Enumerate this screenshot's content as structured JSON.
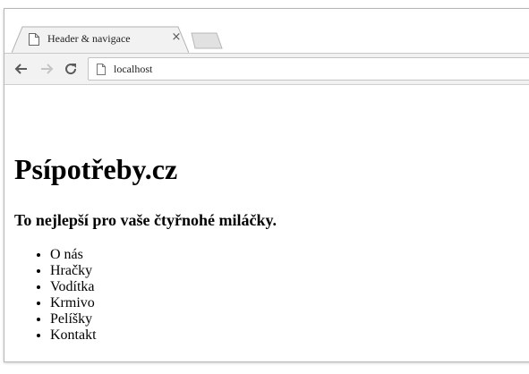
{
  "browser": {
    "tab": {
      "title": "Header & navigace",
      "close_glyph": "×",
      "favicon": "page-icon"
    },
    "address": {
      "url": "localhost",
      "icon": "page-icon"
    },
    "nav_icons": [
      "back-arrow-icon",
      "forward-arrow-icon",
      "reload-icon"
    ]
  },
  "page": {
    "title": "Psípotřeby.cz",
    "subtitle": "To nejlepší pro vaše čtyřnohé miláčky.",
    "nav": [
      {
        "label": "O nás"
      },
      {
        "label": "Hračky"
      },
      {
        "label": "Vodítka"
      },
      {
        "label": "Krmivo"
      },
      {
        "label": "Pelíšky"
      },
      {
        "label": "Kontakt"
      }
    ]
  },
  "colors": {
    "toolbar": "#f2f2f2",
    "tab_border": "#b3b3b3",
    "text": "#000000"
  }
}
